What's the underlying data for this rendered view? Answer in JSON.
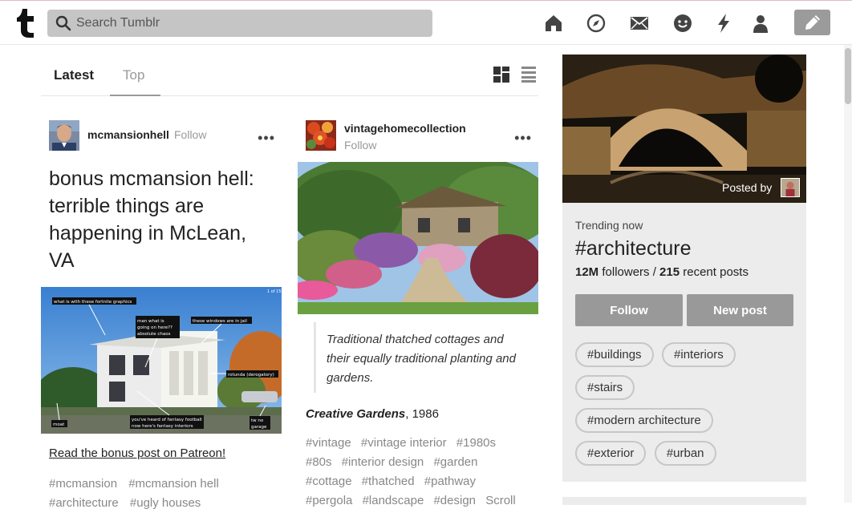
{
  "header": {
    "logo": "t",
    "search_placeholder": "Search Tumblr",
    "icons": [
      "home-icon",
      "explore-icon",
      "inbox-icon",
      "chat-icon",
      "activity-icon",
      "account-icon",
      "compose-icon"
    ]
  },
  "tabs": [
    {
      "label": "Latest",
      "active": true
    },
    {
      "label": "Top",
      "active": false
    }
  ],
  "posts": [
    {
      "blog": "mcmansionhell",
      "follow": "Follow",
      "title": "bonus mcmansion hell: terrible things are happening in McLean, VA",
      "image_annotations": [
        "what is with these fortnite graphics",
        "man what is going on here?? absolute chaos",
        "these windows are in jail",
        "rotunda (derogatory)",
        "you've heard of fantasy football now here's fantasy interiors",
        "moat",
        "tw no garage",
        "1 of 15"
      ],
      "link": "Read the bonus post on Patreon!",
      "tags": [
        "#mcmansion",
        "#mcmansion hell",
        "#architecture",
        "#ugly houses"
      ]
    },
    {
      "blog": "vintagehomecollection",
      "follow": "Follow",
      "quote": "Traditional thatched cottages and their equally traditional planting and gardens.",
      "caption_title": "Creative Gardens",
      "caption_year": ", 1986",
      "tags": [
        "#vintage",
        "#vintage interior",
        "#1980s",
        "#80s",
        "#interior design",
        "#garden",
        "#cottage",
        "#thatched",
        "#pathway",
        "#pergola",
        "#landscape",
        "#design",
        "Scroll"
      ]
    }
  ],
  "trending": {
    "posted_by": "Posted by",
    "label": "Trending now",
    "tag": "#architecture",
    "followers": "12M",
    "followers_text": " followers / ",
    "posts": "215",
    "posts_text": " recent posts",
    "follow_button": "Follow",
    "new_post_button": "New post",
    "related_tags": [
      "#buildings",
      "#interiors",
      "#stairs",
      "#modern architecture",
      "#exterior",
      "#urban"
    ]
  },
  "colors": {
    "search_bg": "#c5c5c5",
    "button_bg": "#999999",
    "card_bg": "#ececec"
  }
}
